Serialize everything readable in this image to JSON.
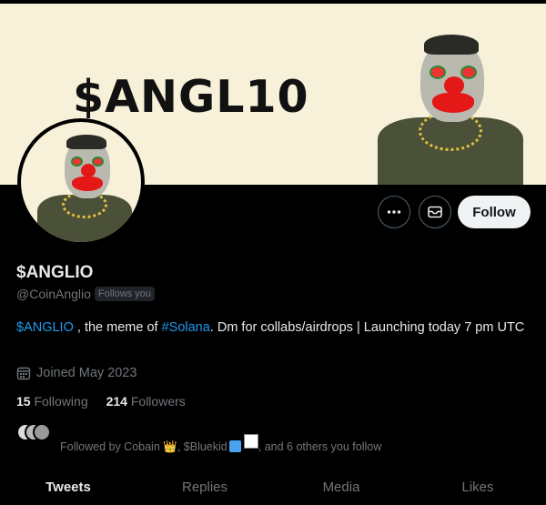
{
  "profile": {
    "brand_text": "$ANGL10",
    "display_name": "$ANGLIO",
    "handle": "@CoinAnglio",
    "follows_you": "Follows you"
  },
  "actions": {
    "more_icon": "more-dots-icon",
    "message_icon": "envelope-icon",
    "follow_label": "Follow"
  },
  "bio": {
    "mention": "$ANGLIO",
    "part1": " , the meme of ",
    "hashtag": "#Solana",
    "part2": ". Dm for collabs/airdrops | Launching today 7 pm UTC"
  },
  "joined": {
    "icon": "calendar-icon",
    "text": "Joined May 2023"
  },
  "stats": {
    "following_count": "15",
    "following_label": "Following",
    "followers_count": "214",
    "followers_label": "Followers"
  },
  "followed_by": {
    "prefix": "Followed by Cobain ",
    "crown": "👑",
    "middle": ", $Bluekid",
    "suffix": ", and 6 others you follow"
  },
  "tabs": [
    "Tweets",
    "Replies",
    "Media",
    "Likes"
  ],
  "colors": {
    "accent": "#1d9bf0",
    "banner_bg": "#f8f1da",
    "clown_red": "#e51818"
  }
}
